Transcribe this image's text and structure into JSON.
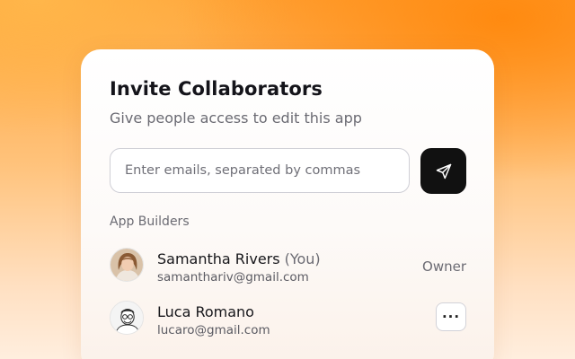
{
  "dialog": {
    "title": "Invite Collaborators",
    "subtitle": "Give people access to edit this app"
  },
  "invite": {
    "input_value": "",
    "placeholder": "Enter emails, separated by commas",
    "send_icon": "send-icon"
  },
  "section": {
    "label": "App Builders"
  },
  "collaborators": [
    {
      "name": "Samantha Rivers",
      "tag": "(You)",
      "email": "samanthariv@gmail.com",
      "role": "Owner",
      "avatar": "avatar-woman"
    },
    {
      "name": "Luca Romano",
      "email": "lucaro@gmail.com",
      "more_label": "···",
      "more_icon": "more-horizontal-icon",
      "avatar": "avatar-man-glasses"
    }
  ],
  "colors": {
    "accent_button": "#111111",
    "background_orange": "#ff8a10"
  }
}
